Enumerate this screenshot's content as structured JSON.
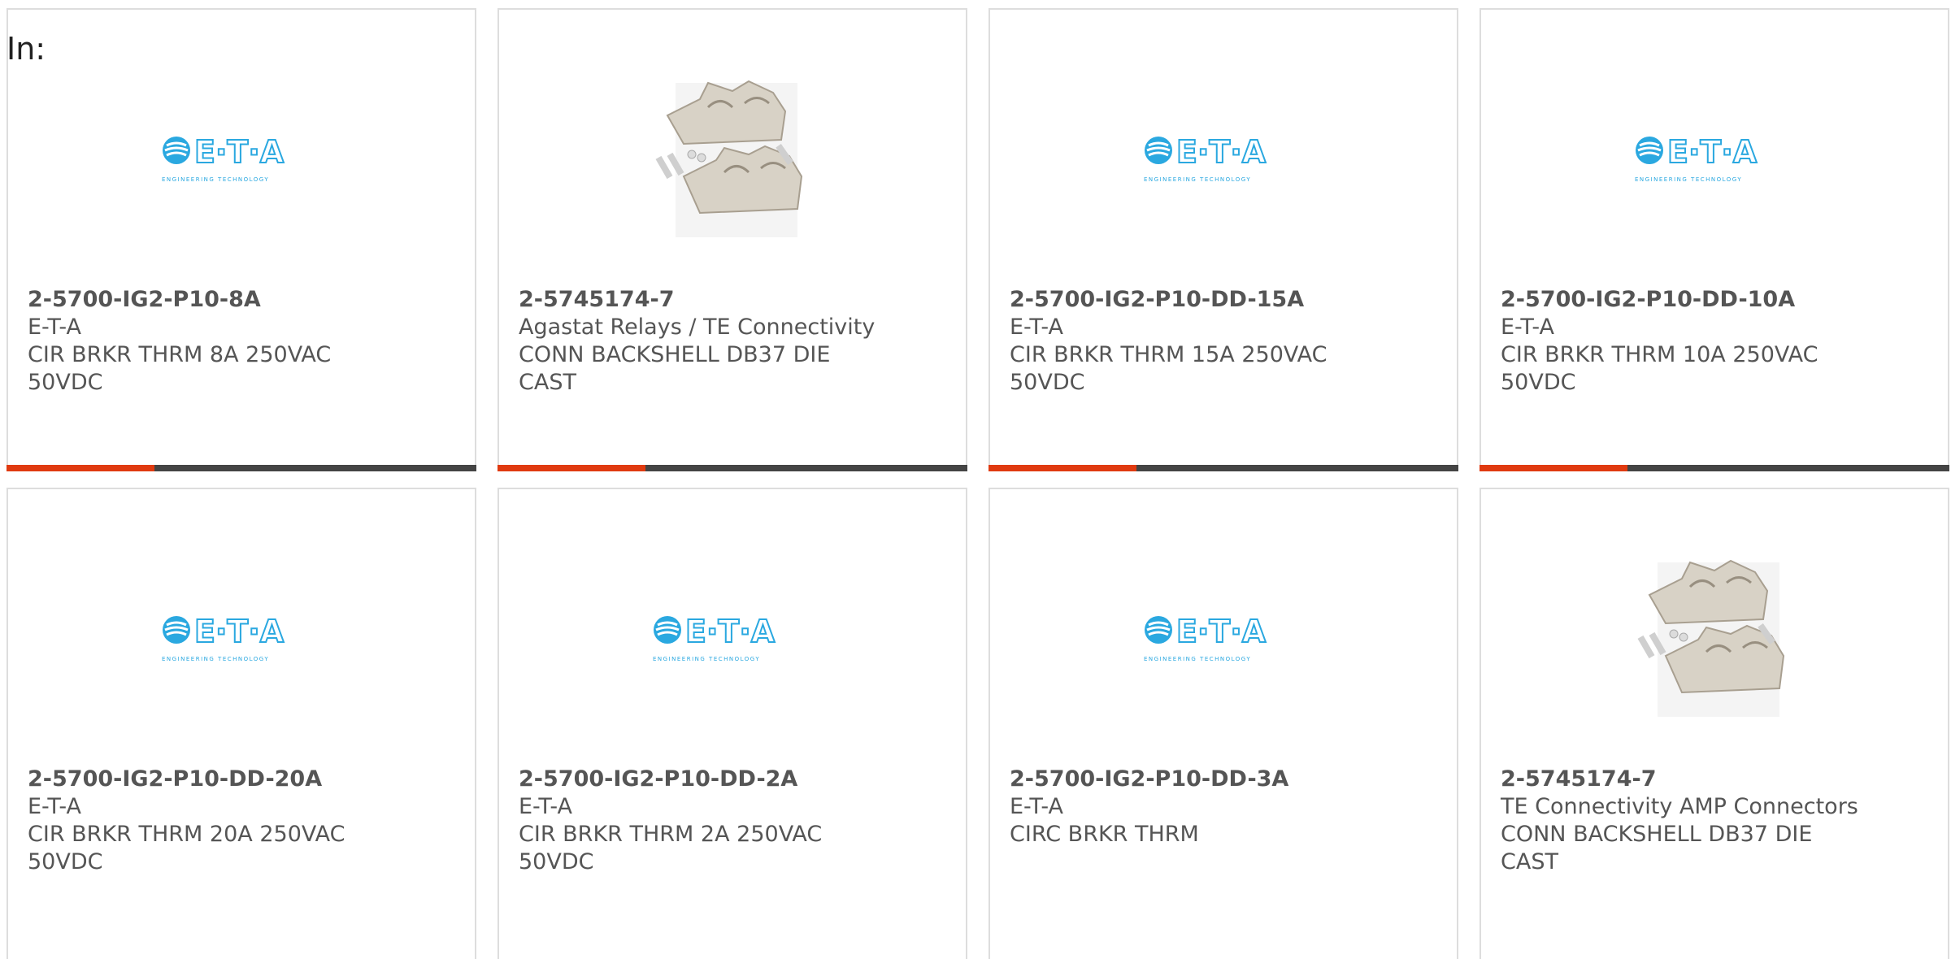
{
  "filter_label": "In:",
  "colors": {
    "accent": "#e03a10",
    "bar_dark": "#444444",
    "eta_blue": "#2aa8e0"
  },
  "logo_texts": {
    "eta_main": "E·T·A",
    "eta_sub": "ENGINEERING TECHNOLOGY"
  },
  "products": [
    {
      "part_number": "2-5700-IG2-P10-8A",
      "manufacturer": "E-T-A",
      "description": "CIR BRKR THRM 8A 250VAC 50VDC",
      "image": "eta-logo"
    },
    {
      "part_number": "2-5745174-7",
      "manufacturer": "Agastat Relays / TE Connectivity",
      "description": "CONN BACKSHELL DB37 DIE CAST",
      "image": "backshell-photo"
    },
    {
      "part_number": "2-5700-IG2-P10-DD-15A",
      "manufacturer": "E-T-A",
      "description": "CIR BRKR THRM 15A 250VAC 50VDC",
      "image": "eta-logo"
    },
    {
      "part_number": "2-5700-IG2-P10-DD-10A",
      "manufacturer": "E-T-A",
      "description": "CIR BRKR THRM 10A 250VAC 50VDC",
      "image": "eta-logo"
    },
    {
      "part_number": "2-5700-IG2-P10-DD-20A",
      "manufacturer": "E-T-A",
      "description": "CIR BRKR THRM 20A 250VAC 50VDC",
      "image": "eta-logo"
    },
    {
      "part_number": "2-5700-IG2-P10-DD-2A",
      "manufacturer": "E-T-A",
      "description": "CIR BRKR THRM 2A 250VAC 50VDC",
      "image": "eta-logo"
    },
    {
      "part_number": "2-5700-IG2-P10-DD-3A",
      "manufacturer": "E-T-A",
      "description": "CIRC BRKR THRM",
      "image": "eta-logo"
    },
    {
      "part_number": "2-5745174-7",
      "manufacturer": "TE Connectivity AMP Connectors",
      "description": "CONN BACKSHELL DB37 DIE CAST",
      "image": "backshell-photo"
    }
  ]
}
